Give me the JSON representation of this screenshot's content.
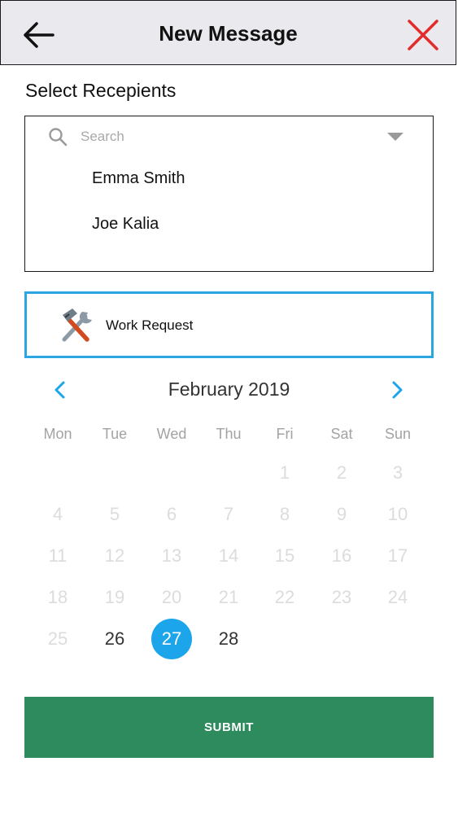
{
  "header": {
    "title": "New Message",
    "back_icon": "arrow-left-icon",
    "close_icon": "close-x-icon",
    "close_color": "#e32b2b"
  },
  "recipients": {
    "label": "Select Recepients",
    "search_placeholder": "Search",
    "items": [
      "Emma Smith",
      "Joe Kalia"
    ]
  },
  "message_type": {
    "label": "Work Request",
    "icon": "tools-icon"
  },
  "calendar": {
    "month_label": "February 2019",
    "prev_icon": "chevron-left-icon",
    "next_icon": "chevron-right-icon",
    "accent_color": "#1da5ec",
    "weekdays": [
      "Mon",
      "Tue",
      "Wed",
      "Thu",
      "Fri",
      "Sat",
      "Sun"
    ],
    "weeks": [
      [
        "",
        "",
        "",
        "",
        "1",
        "2",
        "3"
      ],
      [
        "4",
        "5",
        "6",
        "7",
        "8",
        "9",
        "10"
      ],
      [
        "11",
        "12",
        "13",
        "14",
        "15",
        "16",
        "17"
      ],
      [
        "18",
        "19",
        "20",
        "21",
        "22",
        "23",
        "24"
      ],
      [
        "25",
        "26",
        "27",
        "28",
        "",
        "",
        ""
      ]
    ],
    "enabled_days": [
      "26",
      "27",
      "28"
    ],
    "selected_day": "27"
  },
  "submit": {
    "label": "SUBMIT",
    "color": "#2d8b5e"
  }
}
